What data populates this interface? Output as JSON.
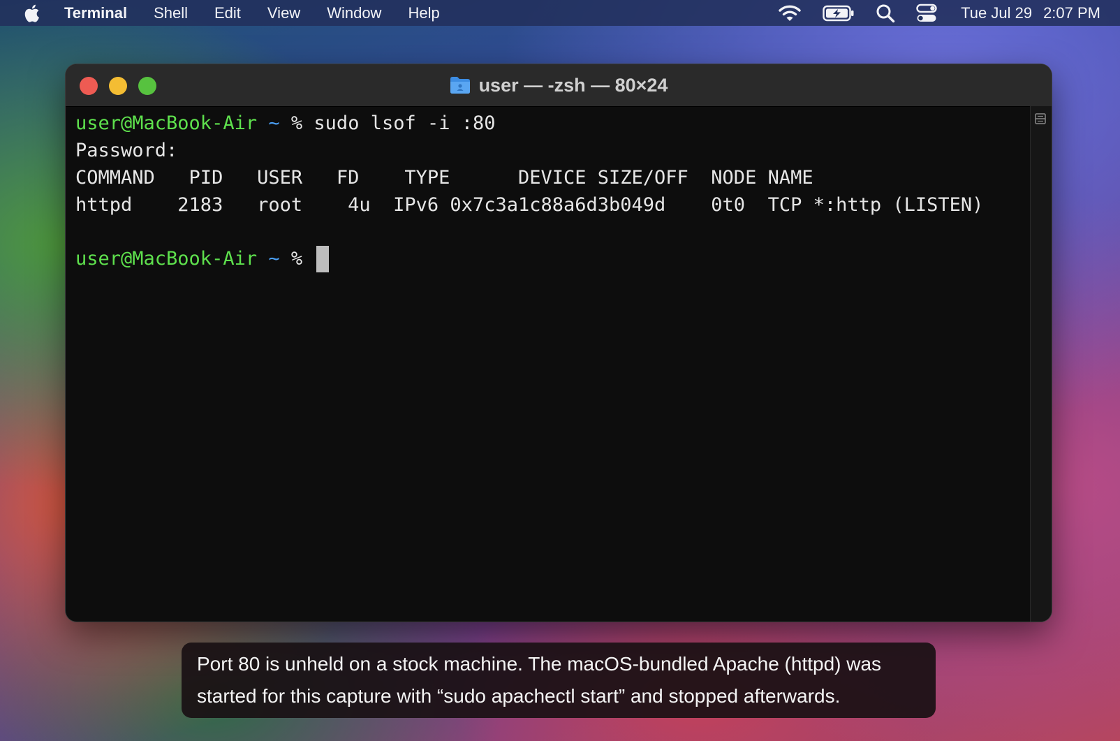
{
  "menubar": {
    "apple_icon": "apple-icon",
    "app_name": "Terminal",
    "menus": [
      "Shell",
      "Edit",
      "View",
      "Window",
      "Help"
    ],
    "status_icons": [
      "wifi-icon",
      "battery-charging-icon",
      "search-icon",
      "control-center-icon"
    ],
    "date": "Tue Jul 29",
    "time": "2:07 PM"
  },
  "window": {
    "title": "user — -zsh — 80×24",
    "title_icon": "folder-icon"
  },
  "terminal": {
    "prompt_user": "user@MacBook-Air",
    "prompt_tilde": "~",
    "prompt_symbol": "%",
    "command": "sudo lsof -i :80",
    "password_line": "Password:",
    "header_line": "COMMAND   PID   USER   FD    TYPE      DEVICE SIZE/OFF  NODE NAME",
    "output_line": "httpd    2183   root    4u  IPv6 0x7c3a1c88a6d3b049d    0t0  TCP *:http (LISTEN)"
  },
  "caption": {
    "text": "Port 80 is unheld on a stock machine. The macOS-bundled Apache (httpd) was started for this capture with “sudo apachectl start” and stopped afterwards."
  },
  "colors": {
    "prompt_user": "#5ee04d",
    "prompt_tilde": "#4a9ff5",
    "close": "#ee5b53",
    "minimize": "#f4bd33",
    "maximize": "#57c23f"
  }
}
